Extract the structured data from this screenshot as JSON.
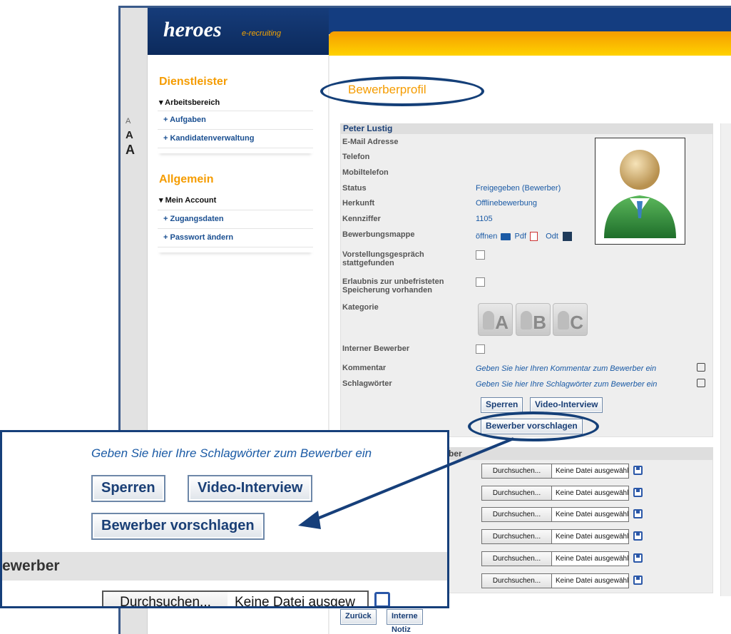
{
  "logo": {
    "name": "heroes",
    "tagline": "e-recruiting"
  },
  "font_sizer": [
    "A",
    "A",
    "A"
  ],
  "sidebar": {
    "sections": [
      {
        "title": "Dienstleister",
        "group": "▾ Arbeitsbereich",
        "items": [
          "+ Aufgaben",
          "+ Kandidatenverwaltung"
        ]
      },
      {
        "title": "Allgemein",
        "group": "▾ Mein Account",
        "items": [
          "+ Zugangsdaten",
          "+ Passwort ändern"
        ]
      }
    ]
  },
  "page": {
    "title": "Bewerberprofil"
  },
  "profile": {
    "name": "Peter Lustig",
    "fields": [
      {
        "label": "E-Mail Adresse",
        "value": ""
      },
      {
        "label": "Telefon",
        "value": ""
      },
      {
        "label": "Mobiltelefon",
        "value": ""
      },
      {
        "label": "Status",
        "value": "Freigegeben (Bewerber)"
      },
      {
        "label": "Herkunft",
        "value": "Offlinebewerbung"
      },
      {
        "label": "Kennziffer",
        "value": "1105"
      }
    ],
    "bewerbungsmappe": {
      "label": "Bewerbungsmappe",
      "open": "öffnen",
      "pdf": "Pdf",
      "odt": "Odt"
    },
    "checkboxes": [
      {
        "label_line1": "Vorstellungsgespräch",
        "label_line2": "stattgefunden",
        "checked": false
      },
      {
        "label_line1": "Erlaubnis zur unbefristeten",
        "label_line2": "Speicherung vorhanden",
        "checked": false
      }
    ],
    "kategorie": {
      "label": "Kategorie",
      "options": [
        "A",
        "B",
        "C"
      ]
    },
    "interner_bewerber": {
      "label": "Interner Bewerber",
      "checked": false
    },
    "kommentar": {
      "label": "Kommentar",
      "placeholder": "Geben Sie hier Ihren Kommentar zum Bewerber ein"
    },
    "schlagwoerter": {
      "label": "Schlagwörter",
      "placeholder": "Geben Sie hier Ihre Schlagwörter zum Bewerber ein"
    },
    "buttons": {
      "sperren": "Sperren",
      "video": "Video-Interview",
      "vorschlagen": "Bewerber vorschlagen"
    }
  },
  "files": {
    "header": "ber",
    "browse_label": "Durchsuchen...",
    "no_file": "Keine Datei ausgewählt",
    "rows": 6
  },
  "bottom": {
    "back": "Zurück",
    "note": "Interne Notiz"
  },
  "zoom": {
    "text": "Geben Sie hier Ihre Schlagwörter zum Bewerber ein",
    "sperren": "Sperren",
    "video": "Video-Interview",
    "vorschlagen": "Bewerber vorschlagen",
    "band": "ewerber",
    "browse": "Durchsuchen...",
    "no_file": "Keine Datei ausgew"
  },
  "colors": {
    "brand_navy": "#143d80",
    "accent_orange": "#f59c00",
    "link_blue": "#1a5aa5"
  }
}
